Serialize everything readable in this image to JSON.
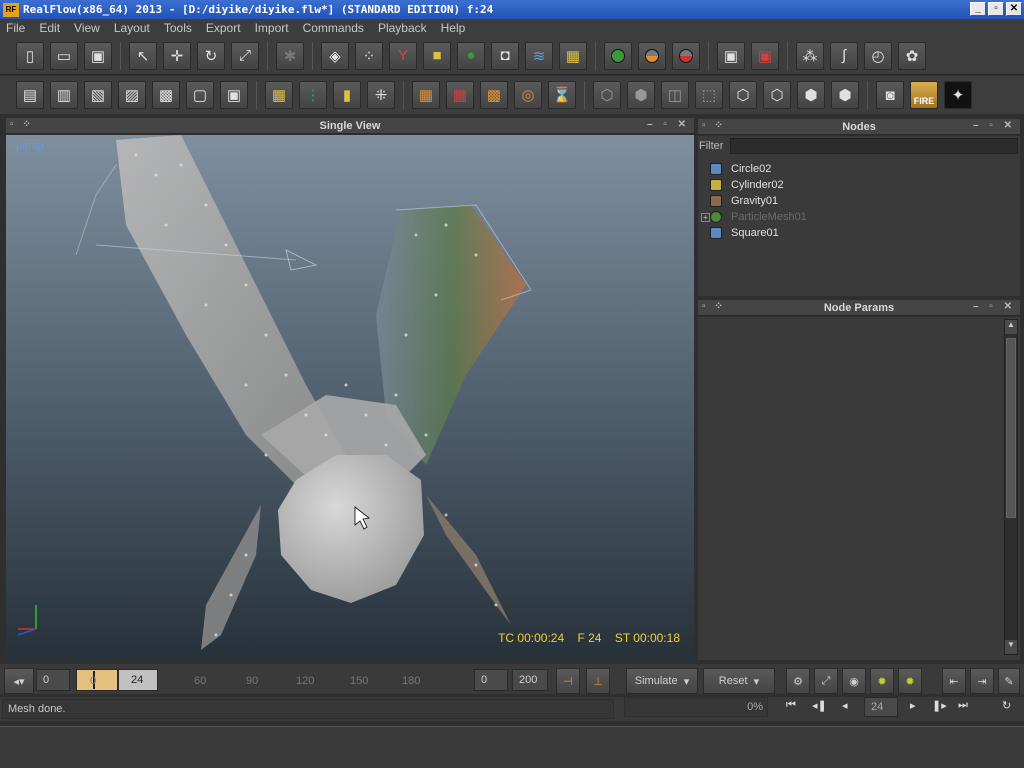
{
  "window": {
    "title": "RealFlow(x86_64) 2013 - [D:/diyike/diyike.flw*] (STANDARD EDITION) f:24",
    "app_icon_label": "RF"
  },
  "menu": [
    "File",
    "Edit",
    "View",
    "Layout",
    "Tools",
    "Export",
    "Import",
    "Commands",
    "Playback",
    "Help"
  ],
  "viewport": {
    "title": "Single View",
    "camera": "persp",
    "timecode": "TC 00:00:24",
    "frame": "F 24",
    "sim_time": "ST 00:00:18"
  },
  "nodes": {
    "title": "Nodes",
    "filter_label": "Filter",
    "items": [
      {
        "label": "Circle02",
        "icon": "emitter-icon",
        "color": "#5a8ac0"
      },
      {
        "label": "Cylinder02",
        "icon": "object-icon",
        "color": "#c8b040"
      },
      {
        "label": "Gravity01",
        "icon": "daemon-icon",
        "color": "#8a6a4a"
      },
      {
        "label": "ParticleMesh01",
        "icon": "mesh-icon",
        "color": "#4a8a3a",
        "dimmed": true
      },
      {
        "label": "Square01",
        "icon": "emitter-icon",
        "color": "#5a8ac0"
      }
    ]
  },
  "node_params": {
    "title": "Node Params"
  },
  "timeline": {
    "start": "0",
    "current": "0",
    "end": "24",
    "ticks": [
      "60",
      "90",
      "120",
      "150",
      "180"
    ],
    "range_start": "0",
    "range_end": "200"
  },
  "buttons": {
    "simulate": "Simulate",
    "reset": "Reset"
  },
  "status": {
    "message": "Mesh done.",
    "progress": "0%",
    "frame": "24"
  },
  "colors": {
    "accent": "#f0d030",
    "range": "#e6c080",
    "camera_label": "#6a9ad8"
  }
}
